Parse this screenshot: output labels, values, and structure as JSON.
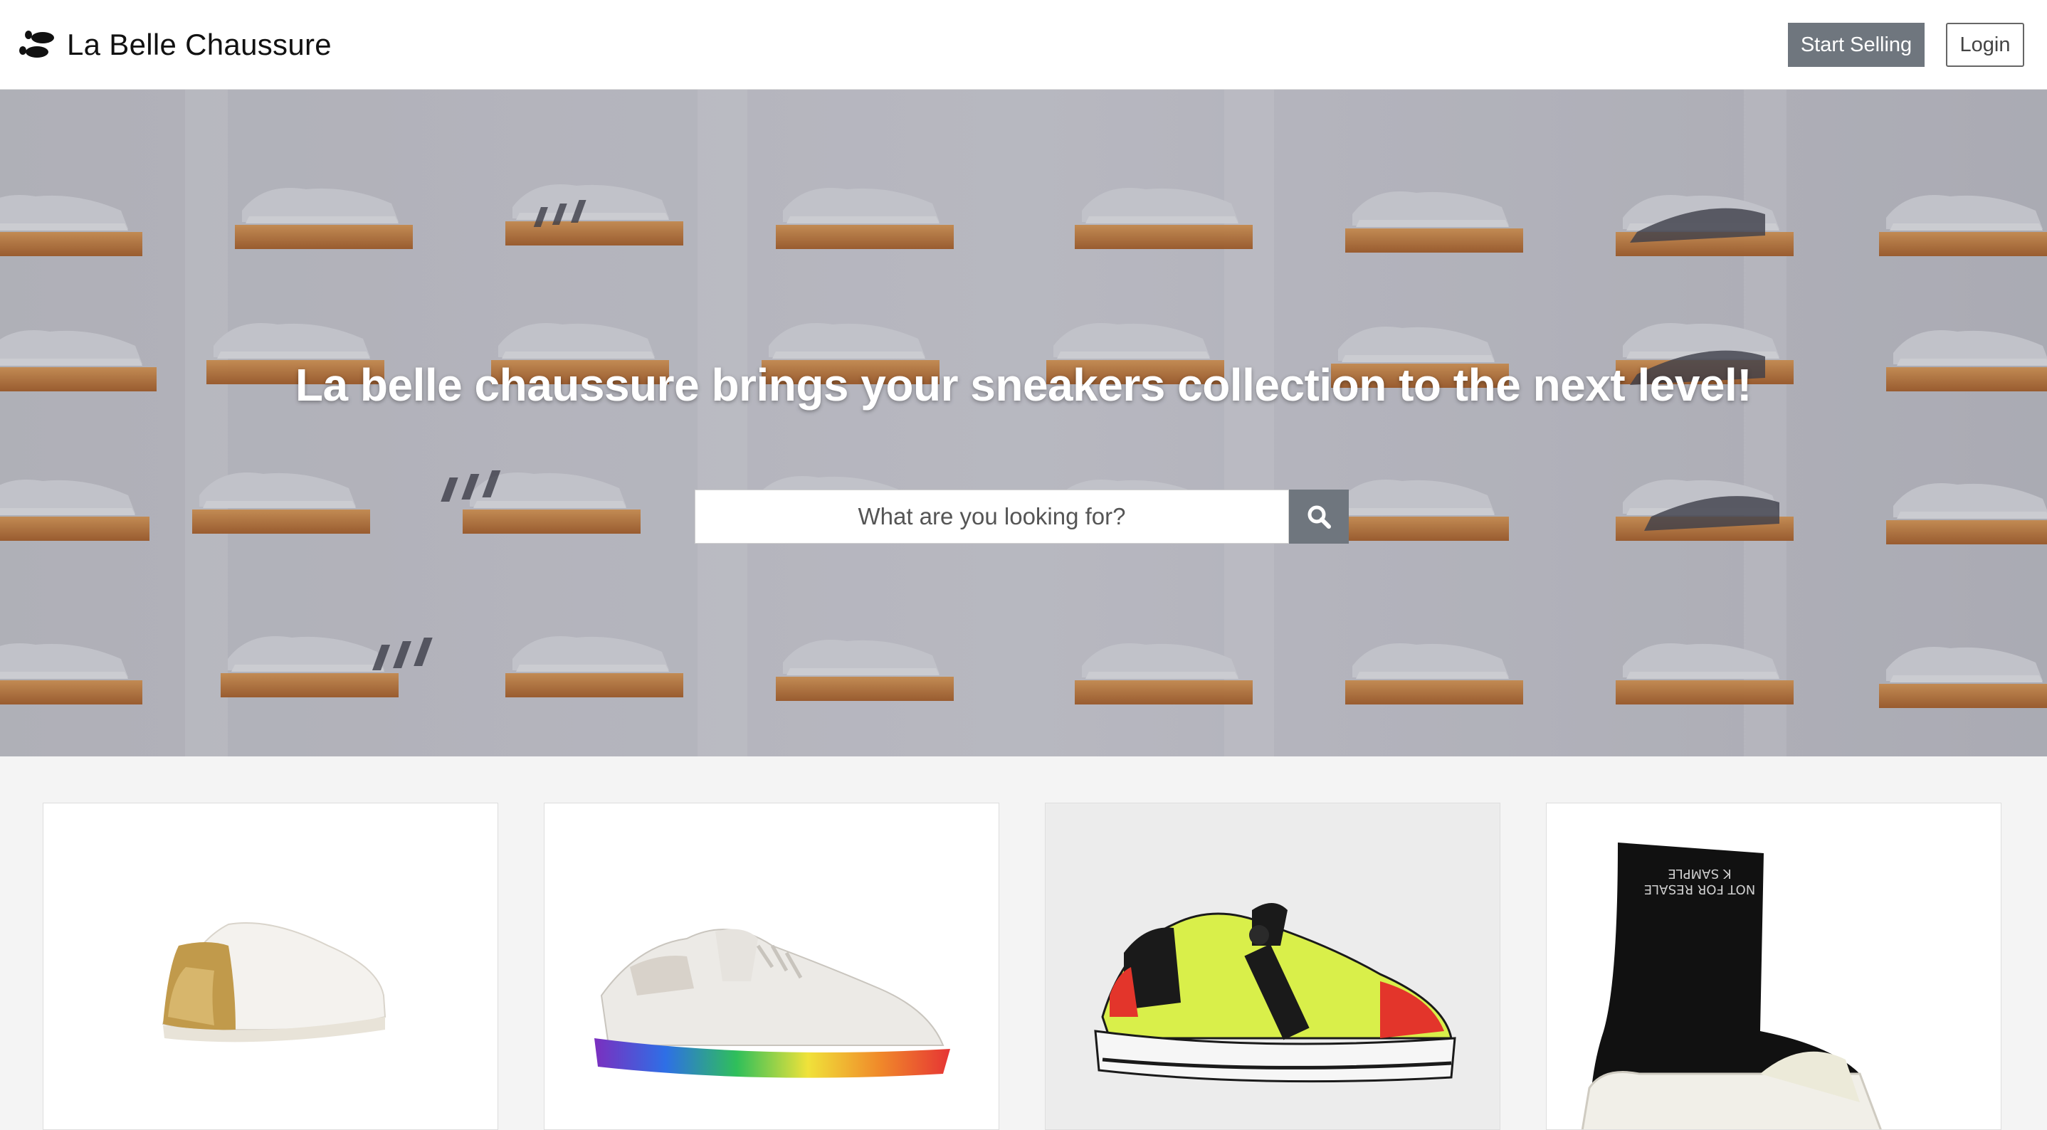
{
  "navbar": {
    "brand_name": "La Belle Chaussure",
    "logo_icon": "footprints-icon",
    "start_selling_label": "Start Selling",
    "login_label": "Login"
  },
  "hero": {
    "title": "La belle chaussure brings your sneakers collection to the next level!",
    "background_description_icon": "sneaker-wall-image",
    "search": {
      "placeholder": "What are you looking for?",
      "value": "",
      "button_icon": "search-icon"
    }
  },
  "products": [
    {
      "image_icon": "gold-white-sneaker-image"
    },
    {
      "image_icon": "rainbow-sneaker-image"
    },
    {
      "image_icon": "neon-pump-sneaker-image"
    },
    {
      "image_icon": "black-sock-sneaker-image",
      "image_text": "NOT FOR RESALE\nK SAMPLE"
    }
  ],
  "colors": {
    "accent_button": "#6f767e",
    "page_background": "#f4f4f4",
    "shelf_orange": "#e58a2e"
  }
}
